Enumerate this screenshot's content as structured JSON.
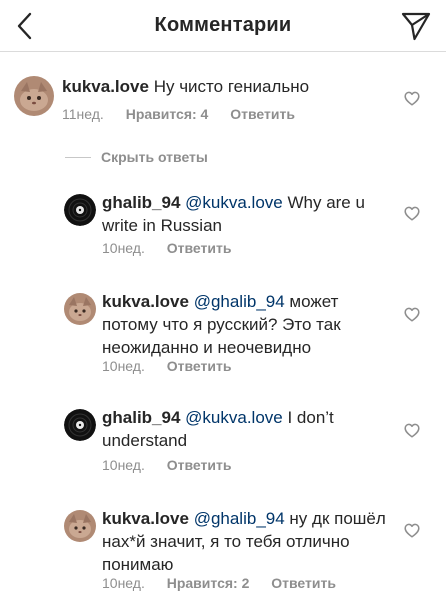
{
  "header": {
    "title": "Комментарии",
    "back_icon": "chevron-left-icon",
    "send_icon": "paper-plane-icon"
  },
  "colors": {
    "text": "#262626",
    "secondary": "#8e8e8e",
    "mention": "#003569",
    "divider": "#dbdbdb"
  },
  "main_comment": {
    "username": "kukva.love",
    "text": "Ну чисто гениально",
    "time": "11нед.",
    "likes": "Нравится: 4",
    "reply": "Ответить"
  },
  "hide_replies": "Скрыть ответы",
  "replies": [
    {
      "username": "ghalib_94",
      "mention": "@kukva.love",
      "text": "Why are u write in Russian",
      "time": "10нед.",
      "likes": "",
      "reply": "Ответить"
    },
    {
      "username": "kukva.love",
      "mention": "@ghalib_94",
      "text": "может потому что я русский? Это так неожиданно и неочевидно",
      "time": "10нед.",
      "likes": "",
      "reply": "Ответить"
    },
    {
      "username": "ghalib_94",
      "mention": "@kukva.love",
      "text": "I don’t understand",
      "time": "10нед.",
      "likes": "",
      "reply": "Ответить"
    },
    {
      "username": "kukva.love",
      "mention": "@ghalib_94",
      "text": "ну дк пошёл нах*й значит, я то тебя отлично понимаю",
      "time": "10нед.",
      "likes": "Нравится: 2",
      "reply": "Ответить"
    }
  ]
}
